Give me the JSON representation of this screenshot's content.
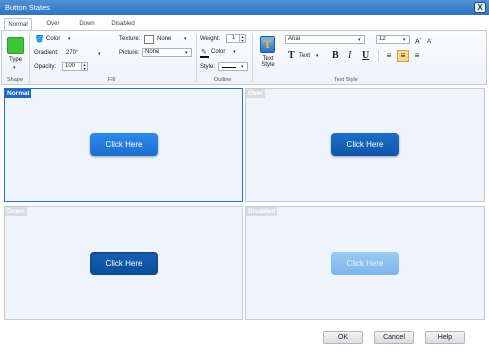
{
  "window": {
    "title": "Button States",
    "close_glyph": "X"
  },
  "tabs": [
    {
      "label": "Normal",
      "active": true
    },
    {
      "label": "Over",
      "active": false
    },
    {
      "label": "Down",
      "active": false
    },
    {
      "label": "Disabled",
      "active": false
    }
  ],
  "ribbon": {
    "shape": {
      "type_label": "Type",
      "group_label": "Shape",
      "swatch_color": "#3ec63a"
    },
    "fill": {
      "color_label": "Color",
      "gradient_label": "Gradient:",
      "gradient_value": "270°",
      "opacity_label": "Opacity:",
      "opacity_value": "100",
      "texture_label": "Texture:",
      "texture_value": "None",
      "picture_label": "Picture:",
      "picture_value": "None",
      "group_label": "Fill"
    },
    "outline": {
      "weight_label": "Weight:",
      "weight_value": "1",
      "color_label": "Color",
      "style_label": "Style:",
      "group_label": "Outline"
    },
    "text_style": {
      "text_style_label": "Text Style",
      "font_value": "Arial",
      "size_value": "12",
      "text_label": "Text",
      "group_label": "Text Style"
    }
  },
  "panels": {
    "normal": {
      "label": "Normal",
      "button_text": "Click Here",
      "button_color": "#1e7ad9"
    },
    "over": {
      "label": "Over",
      "button_text": "Click Here",
      "button_color": "#1466bf"
    },
    "down": {
      "label": "Down",
      "button_text": "Click Here",
      "button_color": "#0f56a8"
    },
    "disabled": {
      "label": "Disabled",
      "button_text": "Click Here",
      "button_color": "#8ec0ee"
    }
  },
  "dialog_buttons": {
    "ok": "OK",
    "cancel": "Cancel",
    "help": "Help"
  }
}
